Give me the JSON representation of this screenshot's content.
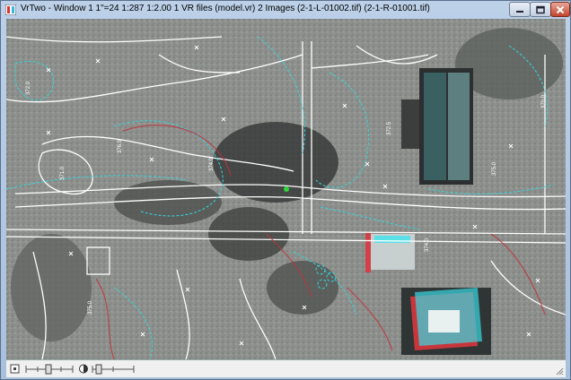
{
  "window": {
    "title": "VrTwo - Window 1   1\"=24   1:287   1:2.00   1 VR files (model.vr)   2 Images (2-1-L-01002.tif) (2-1-R-01001.tif)"
  },
  "title_buttons": {
    "minimize_icon": "minimize-icon",
    "maximize_icon": "maximize-icon",
    "close_icon": "close-icon"
  },
  "viewport": {
    "content": "anaglyph stereo aerial photo with vector contour overlay",
    "colors": {
      "ground": "#8a8e8a",
      "red": "#c0323c",
      "cyan": "#35d6e0",
      "vector": "#ffffff",
      "marker": "#2fd43a"
    },
    "contour_labels": [
      "372.0",
      "376.0",
      "371.0",
      "374.0",
      "372.5",
      "375.0",
      "370.0",
      "375.0",
      "374.0"
    ]
  },
  "statusbar": {
    "controls": [
      {
        "name": "zoom-slider",
        "icon": "slider-icon"
      },
      {
        "name": "contrast-toggle",
        "icon": "contrast-icon"
      },
      {
        "name": "brightness-slider",
        "icon": "slider-icon"
      }
    ]
  }
}
